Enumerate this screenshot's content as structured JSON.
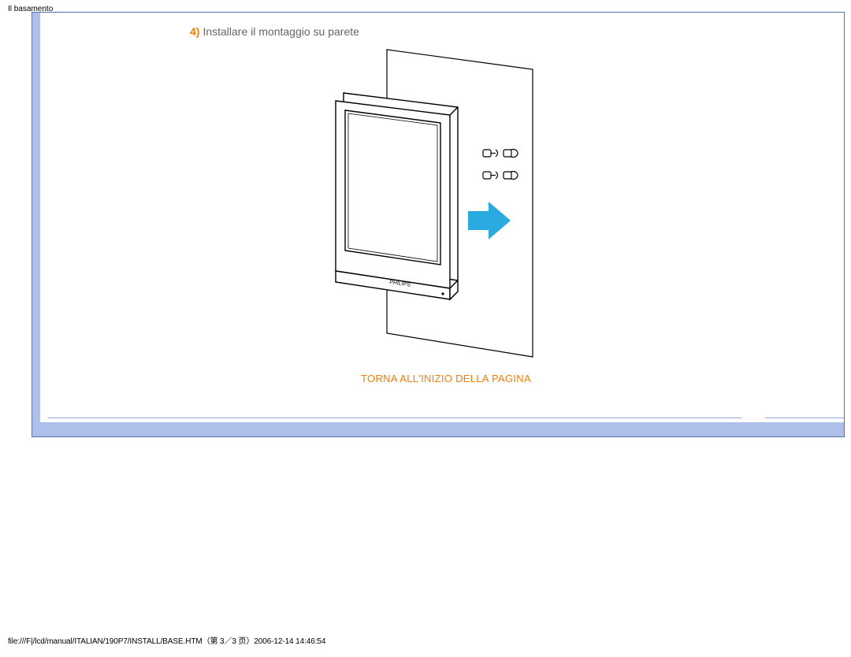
{
  "header": {
    "title": "Il basamento"
  },
  "step": {
    "number": "4)",
    "text": "Installare il montaggio su parete"
  },
  "link": {
    "back_to_top": "TORNA ALL'INIZIO DELLA PAGINA"
  },
  "footer": {
    "path": "file:///F|/lcd/manual/ITALIAN/190P7/INSTALL/BASE.HTM（第 3／3 页）2006-12-14 14:46:54"
  },
  "figure": {
    "brand": "PHILIPS",
    "icon": "arrow-right"
  }
}
